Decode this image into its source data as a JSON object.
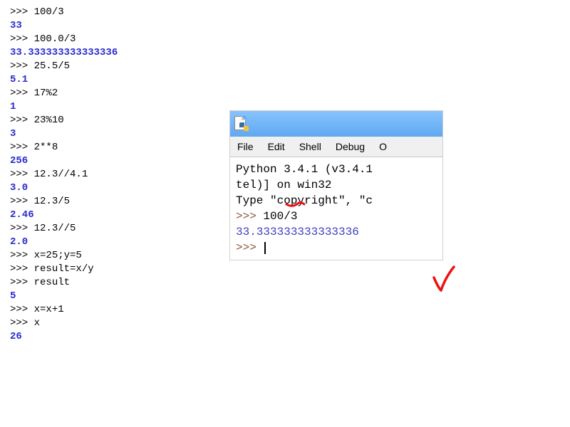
{
  "left_shell": [
    {
      "in": "100/3",
      "out": "33"
    },
    {
      "in": "100.0/3",
      "out": "33.333333333333336"
    },
    {
      "in": "25.5/5",
      "out": "5.1"
    },
    {
      "in": "17%2",
      "out": "1"
    },
    {
      "in": "23%10",
      "out": "3"
    },
    {
      "in": "2**8",
      "out": "256"
    },
    {
      "in": "12.3//4.1",
      "out": "3.0"
    },
    {
      "in": "12.3/5",
      "out": "2.46"
    },
    {
      "in": "12.3//5",
      "out": "2.0"
    },
    {
      "in": "x=25;y=5",
      "out": null
    },
    {
      "in": "result=x/y",
      "out": null
    },
    {
      "in": "result",
      "out": "5"
    },
    {
      "in": "x=x+1",
      "out": null
    },
    {
      "in": "x",
      "out": "26"
    }
  ],
  "prompt": ">>> ",
  "idle": {
    "menus": {
      "file": "File",
      "edit": "Edit",
      "shell": "Shell",
      "debug": "Debug",
      "options_cut": "O"
    },
    "startup_line1": "Python 3.4.1 (v3.4.1",
    "startup_line2": "tel)] on win32",
    "startup_line3": "Type \"copyright\", \"c",
    "input": "100/3",
    "output": "33.333333333333336",
    "prompt_plain": ">>>"
  }
}
